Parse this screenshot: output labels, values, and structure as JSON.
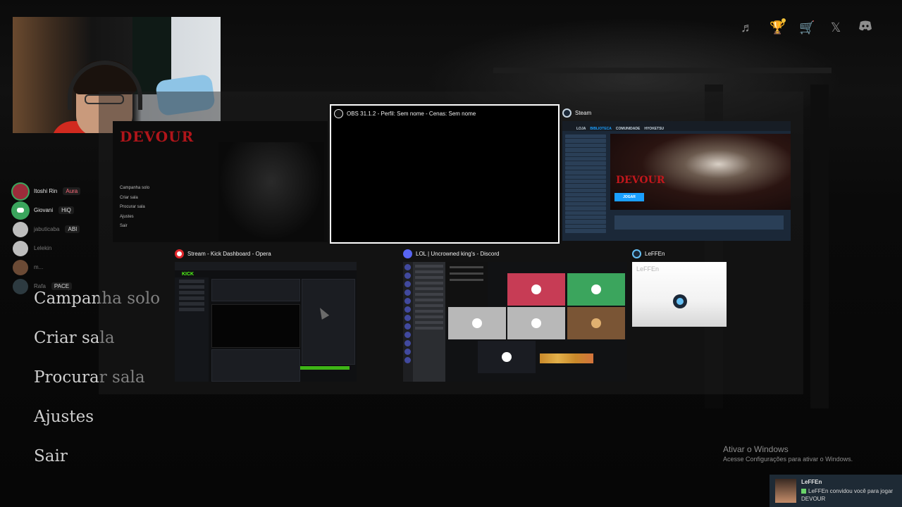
{
  "top_icons": [
    "music-icon",
    "trophy-icon",
    "cart-icon",
    "x-twitter-icon",
    "discord-icon"
  ],
  "game_menu": {
    "items": [
      "Campanha solo",
      "Criar sala",
      "Procurar sala",
      "Ajustes",
      "Sair"
    ]
  },
  "voice_overlay": {
    "users": [
      {
        "name": "Itoshi Rin",
        "badge": "Aura",
        "active": true
      },
      {
        "name": "Giovani",
        "badge": "HiQ",
        "active": true
      },
      {
        "name": "jabuticaba",
        "badge": "ABI",
        "active": false
      },
      {
        "name": "Lelekin",
        "badge": "",
        "active": false
      },
      {
        "name": "m...",
        "badge": "",
        "active": false
      },
      {
        "name": "Rafa",
        "badge": "PACE",
        "active": false
      }
    ]
  },
  "task_switcher": {
    "windows": [
      {
        "title": "",
        "app": "DEVOUR"
      },
      {
        "title": "OBS 31.1.2 - Perfil: Sem nome - Cenas: Sem nome",
        "app": "obs",
        "selected": true
      },
      {
        "title": "Steam",
        "app": "steam"
      },
      {
        "title": "Stream - Kick Dashboard - Opera",
        "app": "opera"
      },
      {
        "title": "LOL | Uncrowned king's - Discord",
        "app": "discord"
      },
      {
        "title": "LeFFEn",
        "app": "steam-chat"
      }
    ],
    "devour_thumb": {
      "logo": "DEVOUR",
      "menu": [
        "Campanha solo",
        "Criar sala",
        "Procurar sala",
        "Ajustes",
        "Sair"
      ]
    },
    "steam_thumb": {
      "nav": [
        "LOJA",
        "BIBLIOTECA",
        "COMUNIDADE",
        "HYOKETSU"
      ],
      "game_logo": "DEVOUR",
      "play_label": "JOGAR"
    },
    "kick_thumb": {
      "logo": "KICK"
    },
    "leffen_thumb": {
      "name": "LeFFEn"
    }
  },
  "windows_activation": {
    "title": "Ativar o Windows",
    "subtitle": "Acesse Configurações para ativar o Windows."
  },
  "toast": {
    "name": "LeFFEn",
    "message": "LeFFEn convidou você para jogar",
    "game": "DEVOUR"
  },
  "colors": {
    "devour_red": "#b0151a",
    "kick_green": "#53fc18",
    "steam_blue": "#1a9fff",
    "discord_blurple": "#5865f2",
    "discord_green": "#3ba55d"
  }
}
